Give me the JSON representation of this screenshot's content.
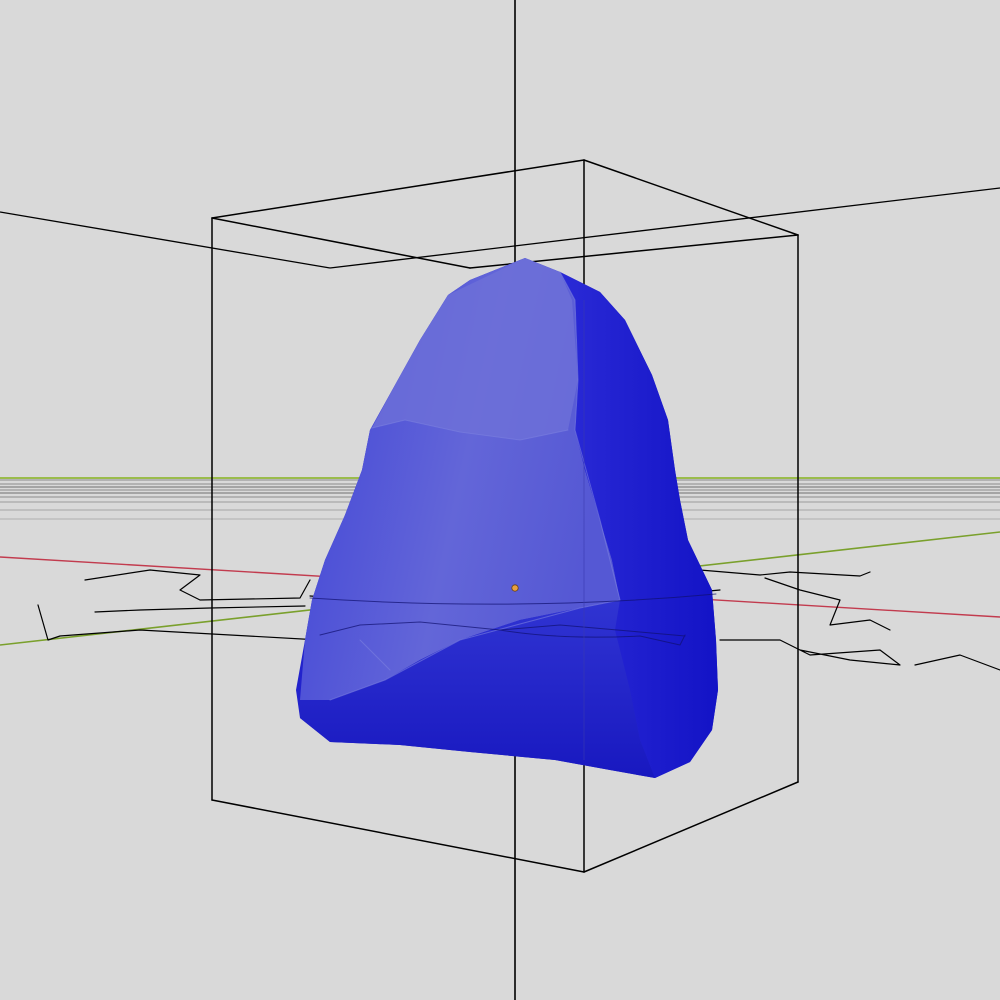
{
  "viewport": {
    "background_color": "#d9d9d9",
    "object_color": "#1a1ad0",
    "object_highlight_color": "#6f72d8",
    "object_shadow_color": "#0f0fb8",
    "bounding_box_color": "#000000",
    "x_axis_color": "#c23b4e",
    "y_axis_color": "#7aa02c",
    "grid_line_color": "#8a8a8a",
    "origin_marker_color": "#e8a040",
    "icons": {
      "origin": "origin-dot-icon"
    }
  }
}
